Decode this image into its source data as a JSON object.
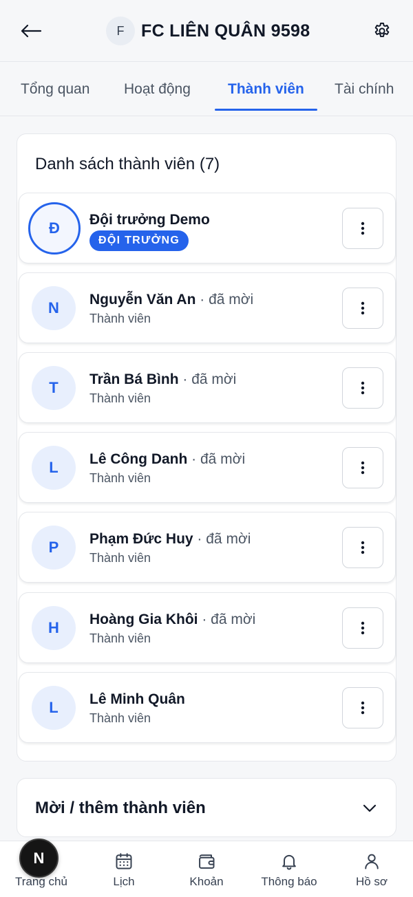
{
  "header": {
    "team_initial": "F",
    "team_name": "FC LIÊN QUÂN 9598"
  },
  "tabs": [
    {
      "label": "Tổng quan",
      "active": false
    },
    {
      "label": "Hoạt động",
      "active": false
    },
    {
      "label": "Thành viên",
      "active": true
    },
    {
      "label": "Tài chính",
      "active": false
    }
  ],
  "members": {
    "title": "Danh sách thành viên (7)",
    "list": [
      {
        "initial": "Đ",
        "name": "Đội trưởng Demo",
        "status": "",
        "role": "",
        "badge": "ĐỘI TRƯỞNG"
      },
      {
        "initial": "N",
        "name": "Nguyễn Văn An",
        "status": " · đã mời",
        "role": "Thành viên",
        "badge": ""
      },
      {
        "initial": "T",
        "name": "Trần Bá Bình",
        "status": " · đã mời",
        "role": "Thành viên",
        "badge": ""
      },
      {
        "initial": "L",
        "name": "Lê Công Danh",
        "status": " · đã mời",
        "role": "Thành viên",
        "badge": ""
      },
      {
        "initial": "P",
        "name": "Phạm Đức Huy",
        "status": " · đã mời",
        "role": "Thành viên",
        "badge": ""
      },
      {
        "initial": "H",
        "name": "Hoàng Gia Khôi",
        "status": " · đã mời",
        "role": "Thành viên",
        "badge": ""
      },
      {
        "initial": "L",
        "name": "Lê Minh Quân",
        "status": "",
        "role": "Thành viên",
        "badge": ""
      }
    ]
  },
  "invite": {
    "title": "Mời / thêm thành viên"
  },
  "bottom_nav": {
    "fab_initial": "N",
    "items": [
      {
        "label": "Trang chủ",
        "icon": "home-icon"
      },
      {
        "label": "Lịch",
        "icon": "calendar-icon"
      },
      {
        "label": "Khoản",
        "icon": "wallet-icon"
      },
      {
        "label": "Thông báo",
        "icon": "bell-icon"
      },
      {
        "label": "Hồ sơ",
        "icon": "user-icon"
      }
    ]
  },
  "colors": {
    "accent": "#2563eb",
    "avatar_bg": "#e8effd",
    "text_primary": "#111827",
    "text_secondary": "#4b5563"
  }
}
